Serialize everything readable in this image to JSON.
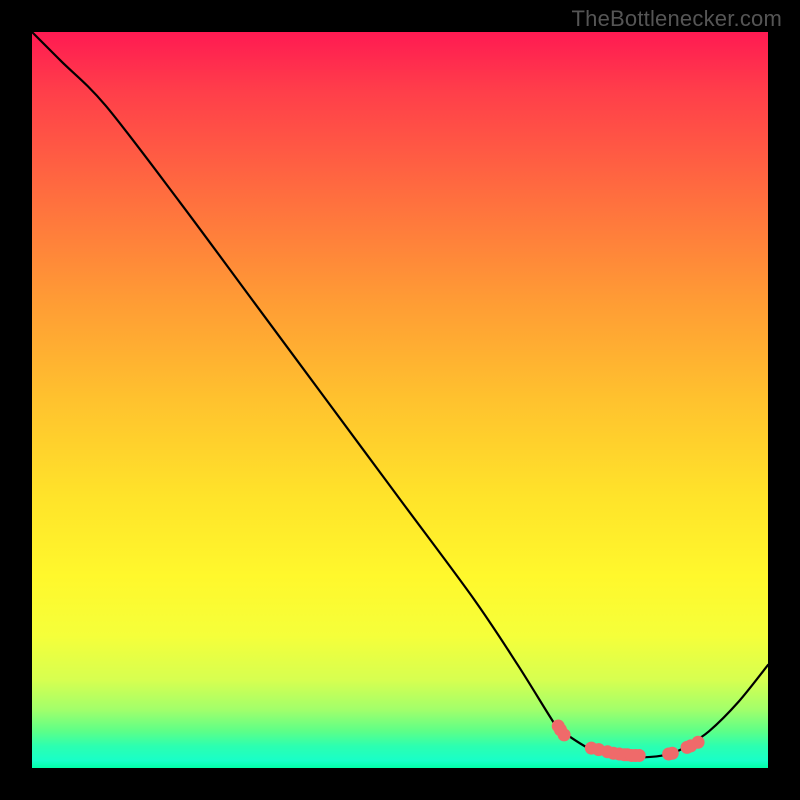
{
  "watermark": "TheBottlenecker.com",
  "colors": {
    "marker": "#ef6a6a",
    "line": "#000000"
  },
  "chart_data": {
    "type": "line",
    "title": "",
    "xlabel": "",
    "ylabel": "",
    "xlim": [
      0,
      100
    ],
    "ylim": [
      0,
      100
    ],
    "grid": false,
    "legend": false,
    "x": [
      0,
      4,
      10,
      20,
      30,
      40,
      50,
      60,
      66,
      71,
      72,
      76,
      80,
      84,
      87,
      89,
      92,
      96,
      100
    ],
    "values": [
      100,
      96,
      90,
      77,
      63.5,
      50,
      36.5,
      23,
      14,
      6,
      5,
      2.5,
      1.5,
      1.5,
      2,
      3,
      5,
      9,
      14
    ],
    "marker_points_x": [
      71.5,
      71.8,
      72.3,
      76,
      77,
      78.2,
      79,
      79.8,
      80.5,
      80.9,
      81.5,
      82,
      82.5,
      86.5,
      87,
      89,
      89.5,
      90.5
    ],
    "marker_points_y": [
      5.7,
      5.2,
      4.5,
      2.7,
      2.5,
      2.2,
      2.0,
      1.9,
      1.8,
      1.8,
      1.7,
      1.7,
      1.7,
      1.9,
      2.0,
      2.8,
      3.0,
      3.5
    ]
  }
}
